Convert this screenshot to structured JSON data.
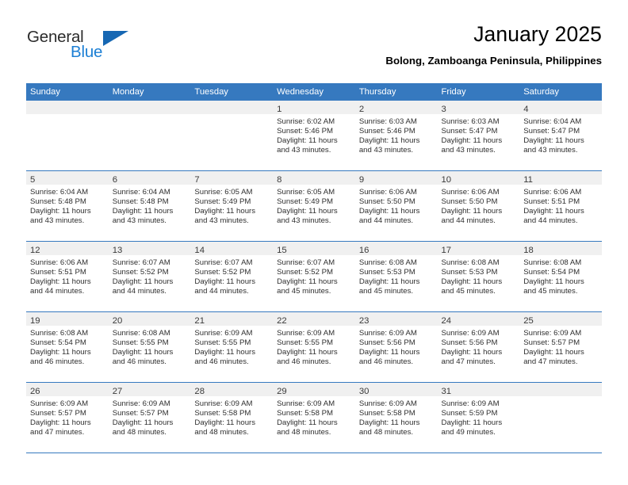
{
  "brand": {
    "name_part1": "General",
    "name_part2": "Blue",
    "accent_color": "#1c7fd4",
    "triangle_color": "#1667b3"
  },
  "header": {
    "title": "January 2025",
    "subtitle": "Bolong, Zamboanga Peninsula, Philippines"
  },
  "theme": {
    "header_blue": "#3679bf",
    "daynum_band": "#f0f0f0",
    "text": "#2f2f2f"
  },
  "weekdays": [
    "Sunday",
    "Monday",
    "Tuesday",
    "Wednesday",
    "Thursday",
    "Friday",
    "Saturday"
  ],
  "labels": {
    "sunrise_prefix": "Sunrise:",
    "sunset_prefix": "Sunset:",
    "daylight_prefix": "Daylight:"
  },
  "weeks": [
    [
      {
        "day": "",
        "empty": true
      },
      {
        "day": "",
        "empty": true
      },
      {
        "day": "",
        "empty": true
      },
      {
        "day": "1",
        "sunrise": "Sunrise: 6:02 AM",
        "sunset": "Sunset: 5:46 PM",
        "daylight_l1": "Daylight: 11 hours",
        "daylight_l2": "and 43 minutes."
      },
      {
        "day": "2",
        "sunrise": "Sunrise: 6:03 AM",
        "sunset": "Sunset: 5:46 PM",
        "daylight_l1": "Daylight: 11 hours",
        "daylight_l2": "and 43 minutes."
      },
      {
        "day": "3",
        "sunrise": "Sunrise: 6:03 AM",
        "sunset": "Sunset: 5:47 PM",
        "daylight_l1": "Daylight: 11 hours",
        "daylight_l2": "and 43 minutes."
      },
      {
        "day": "4",
        "sunrise": "Sunrise: 6:04 AM",
        "sunset": "Sunset: 5:47 PM",
        "daylight_l1": "Daylight: 11 hours",
        "daylight_l2": "and 43 minutes."
      }
    ],
    [
      {
        "day": "5",
        "sunrise": "Sunrise: 6:04 AM",
        "sunset": "Sunset: 5:48 PM",
        "daylight_l1": "Daylight: 11 hours",
        "daylight_l2": "and 43 minutes."
      },
      {
        "day": "6",
        "sunrise": "Sunrise: 6:04 AM",
        "sunset": "Sunset: 5:48 PM",
        "daylight_l1": "Daylight: 11 hours",
        "daylight_l2": "and 43 minutes."
      },
      {
        "day": "7",
        "sunrise": "Sunrise: 6:05 AM",
        "sunset": "Sunset: 5:49 PM",
        "daylight_l1": "Daylight: 11 hours",
        "daylight_l2": "and 43 minutes."
      },
      {
        "day": "8",
        "sunrise": "Sunrise: 6:05 AM",
        "sunset": "Sunset: 5:49 PM",
        "daylight_l1": "Daylight: 11 hours",
        "daylight_l2": "and 43 minutes."
      },
      {
        "day": "9",
        "sunrise": "Sunrise: 6:06 AM",
        "sunset": "Sunset: 5:50 PM",
        "daylight_l1": "Daylight: 11 hours",
        "daylight_l2": "and 44 minutes."
      },
      {
        "day": "10",
        "sunrise": "Sunrise: 6:06 AM",
        "sunset": "Sunset: 5:50 PM",
        "daylight_l1": "Daylight: 11 hours",
        "daylight_l2": "and 44 minutes."
      },
      {
        "day": "11",
        "sunrise": "Sunrise: 6:06 AM",
        "sunset": "Sunset: 5:51 PM",
        "daylight_l1": "Daylight: 11 hours",
        "daylight_l2": "and 44 minutes."
      }
    ],
    [
      {
        "day": "12",
        "sunrise": "Sunrise: 6:06 AM",
        "sunset": "Sunset: 5:51 PM",
        "daylight_l1": "Daylight: 11 hours",
        "daylight_l2": "and 44 minutes."
      },
      {
        "day": "13",
        "sunrise": "Sunrise: 6:07 AM",
        "sunset": "Sunset: 5:52 PM",
        "daylight_l1": "Daylight: 11 hours",
        "daylight_l2": "and 44 minutes."
      },
      {
        "day": "14",
        "sunrise": "Sunrise: 6:07 AM",
        "sunset": "Sunset: 5:52 PM",
        "daylight_l1": "Daylight: 11 hours",
        "daylight_l2": "and 44 minutes."
      },
      {
        "day": "15",
        "sunrise": "Sunrise: 6:07 AM",
        "sunset": "Sunset: 5:52 PM",
        "daylight_l1": "Daylight: 11 hours",
        "daylight_l2": "and 45 minutes."
      },
      {
        "day": "16",
        "sunrise": "Sunrise: 6:08 AM",
        "sunset": "Sunset: 5:53 PM",
        "daylight_l1": "Daylight: 11 hours",
        "daylight_l2": "and 45 minutes."
      },
      {
        "day": "17",
        "sunrise": "Sunrise: 6:08 AM",
        "sunset": "Sunset: 5:53 PM",
        "daylight_l1": "Daylight: 11 hours",
        "daylight_l2": "and 45 minutes."
      },
      {
        "day": "18",
        "sunrise": "Sunrise: 6:08 AM",
        "sunset": "Sunset: 5:54 PM",
        "daylight_l1": "Daylight: 11 hours",
        "daylight_l2": "and 45 minutes."
      }
    ],
    [
      {
        "day": "19",
        "sunrise": "Sunrise: 6:08 AM",
        "sunset": "Sunset: 5:54 PM",
        "daylight_l1": "Daylight: 11 hours",
        "daylight_l2": "and 46 minutes."
      },
      {
        "day": "20",
        "sunrise": "Sunrise: 6:08 AM",
        "sunset": "Sunset: 5:55 PM",
        "daylight_l1": "Daylight: 11 hours",
        "daylight_l2": "and 46 minutes."
      },
      {
        "day": "21",
        "sunrise": "Sunrise: 6:09 AM",
        "sunset": "Sunset: 5:55 PM",
        "daylight_l1": "Daylight: 11 hours",
        "daylight_l2": "and 46 minutes."
      },
      {
        "day": "22",
        "sunrise": "Sunrise: 6:09 AM",
        "sunset": "Sunset: 5:55 PM",
        "daylight_l1": "Daylight: 11 hours",
        "daylight_l2": "and 46 minutes."
      },
      {
        "day": "23",
        "sunrise": "Sunrise: 6:09 AM",
        "sunset": "Sunset: 5:56 PM",
        "daylight_l1": "Daylight: 11 hours",
        "daylight_l2": "and 46 minutes."
      },
      {
        "day": "24",
        "sunrise": "Sunrise: 6:09 AM",
        "sunset": "Sunset: 5:56 PM",
        "daylight_l1": "Daylight: 11 hours",
        "daylight_l2": "and 47 minutes."
      },
      {
        "day": "25",
        "sunrise": "Sunrise: 6:09 AM",
        "sunset": "Sunset: 5:57 PM",
        "daylight_l1": "Daylight: 11 hours",
        "daylight_l2": "and 47 minutes."
      }
    ],
    [
      {
        "day": "26",
        "sunrise": "Sunrise: 6:09 AM",
        "sunset": "Sunset: 5:57 PM",
        "daylight_l1": "Daylight: 11 hours",
        "daylight_l2": "and 47 minutes."
      },
      {
        "day": "27",
        "sunrise": "Sunrise: 6:09 AM",
        "sunset": "Sunset: 5:57 PM",
        "daylight_l1": "Daylight: 11 hours",
        "daylight_l2": "and 48 minutes."
      },
      {
        "day": "28",
        "sunrise": "Sunrise: 6:09 AM",
        "sunset": "Sunset: 5:58 PM",
        "daylight_l1": "Daylight: 11 hours",
        "daylight_l2": "and 48 minutes."
      },
      {
        "day": "29",
        "sunrise": "Sunrise: 6:09 AM",
        "sunset": "Sunset: 5:58 PM",
        "daylight_l1": "Daylight: 11 hours",
        "daylight_l2": "and 48 minutes."
      },
      {
        "day": "30",
        "sunrise": "Sunrise: 6:09 AM",
        "sunset": "Sunset: 5:58 PM",
        "daylight_l1": "Daylight: 11 hours",
        "daylight_l2": "and 48 minutes."
      },
      {
        "day": "31",
        "sunrise": "Sunrise: 6:09 AM",
        "sunset": "Sunset: 5:59 PM",
        "daylight_l1": "Daylight: 11 hours",
        "daylight_l2": "and 49 minutes."
      },
      {
        "day": "",
        "empty": true
      }
    ]
  ]
}
